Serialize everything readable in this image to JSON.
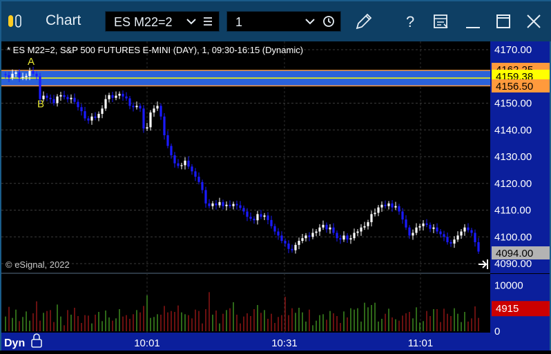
{
  "window": {
    "title": "Chart"
  },
  "toolbar": {
    "symbol": "ES M22=2",
    "interval": "1"
  },
  "icons": {
    "app": "toggle-icon",
    "symbol_dropdown": "chevron-down-icon",
    "symbol_menu": "menu-icon",
    "interval_dropdown": "chevron-down-icon",
    "interval_clock": "clock-icon",
    "draw": "pencil-icon",
    "help": "help-icon",
    "template": "template-icon",
    "minimize": "minimize-icon",
    "maximize": "maximize-icon",
    "close": "close-icon"
  },
  "colors": {
    "titlebar": "#0e3f64",
    "bull_candle": "#ffffff",
    "bear_candle": "#1a1aff",
    "zone_fill": "#2b62d9",
    "zone_border": "#ff9a3c",
    "price_axis_bg": "#0b1f9c",
    "last_price_bg": "#b3b3b3",
    "volume_up": "#4caf28",
    "volume_down": "#b21a1a",
    "volume_label_bg": "#cc0000"
  },
  "chart_data": {
    "type": "candlestick",
    "title": "* ES M22=2, S&P 500 FUTURES E-MINI (DAY), 1, 09:30-16:15 (Dynamic)",
    "copyright": "© eSignal, 2022",
    "price_axis": {
      "ticks": [
        "4170.00",
        "4160.00",
        "4150.00",
        "4140.00",
        "4130.00",
        "4120.00",
        "4110.00",
        "4100.00",
        "4090.00"
      ],
      "range": [
        4089,
        4173
      ]
    },
    "price_labels": [
      {
        "value": "4162.25",
        "color": "#ff9a3c"
      },
      {
        "value": "4159.38",
        "color": "#ffff00"
      },
      {
        "value": "4156.50",
        "color": "#ff9a3c"
      },
      {
        "value": "4094.00",
        "color": "#b3b3b3"
      }
    ],
    "zone": {
      "top": 4162.25,
      "mid": 4159.38,
      "bottom": 4156.5,
      "label_top": "A",
      "label_bottom": "B"
    },
    "time_axis": {
      "ticks": [
        "10:01",
        "10:31",
        "11:01"
      ],
      "left_label": "Dyn"
    },
    "volume_axis": {
      "ticks": [
        "10000",
        "0"
      ],
      "range": [
        0,
        12000
      ]
    },
    "volume_label": "4915",
    "closes": [
      4160.5,
      4159.5,
      4161.0,
      4161.5,
      4159.5,
      4159.8,
      4160.2,
      4162.0,
      4161.0,
      4160.0,
      4151.5,
      4152.8,
      4152.0,
      4151.5,
      4150.0,
      4152.5,
      4153.0,
      4152.3,
      4151.5,
      4152.0,
      4150.5,
      4148.5,
      4147.0,
      4144.3,
      4143.5,
      4145.0,
      4144.5,
      4146.0,
      4148.0,
      4151.5,
      4153.0,
      4152.0,
      4152.8,
      4153.5,
      4152.5,
      4151.8,
      4149.0,
      4148.5,
      4149.0,
      4148.0,
      4140.5,
      4141.0,
      4146.5,
      4148.0,
      4149.0,
      4145.0,
      4138.0,
      4134.0,
      4130.5,
      4127.5,
      4126.5,
      4126.8,
      4128.5,
      4126.3,
      4124.5,
      4122.5,
      4120.5,
      4117.5,
      4112.5,
      4111.5,
      4112.5,
      4111.8,
      4113.0,
      4111.5,
      4112.0,
      4111.5,
      4112.3,
      4111.8,
      4110.8,
      4109.5,
      4107.5,
      4106.8,
      4106.2,
      4108.5,
      4107.5,
      4108.0,
      4106.3,
      4104.0,
      4102.0,
      4100.5,
      4098.5,
      4097.5,
      4095.5,
      4095.0,
      4097.0,
      4098.5,
      4099.5,
      4100.5,
      4100.0,
      4101.5,
      4102.0,
      4103.5,
      4104.5,
      4102.8,
      4103.5,
      4101.5,
      4099.5,
      4099.0,
      4100.5,
      4099.0,
      4099.5,
      4101.5,
      4102.0,
      4103.5,
      4104.0,
      4105.5,
      4108.5,
      4109.0,
      4111.0,
      4112.0,
      4111.5,
      4112.5,
      4111.0,
      4111.5,
      4109.5,
      4106.5,
      4103.5,
      4100.5,
      4101.5,
      4103.5,
      4104.0,
      4105.0,
      4104.5,
      4103.0,
      4103.5,
      4102.0,
      4101.0,
      4100.0,
      4098.0,
      4097.5,
      4099.0,
      4100.5,
      4102.0,
      4103.5,
      4102.5,
      4101.5,
      4098.0,
      4094.5
    ],
    "volumes": [
      3200,
      5300,
      2900,
      4700,
      2200,
      3100,
      4300,
      2300,
      3900,
      6500,
      2300,
      4000,
      4400,
      4600,
      2000,
      5800,
      3200,
      1300,
      4600,
      3600,
      5100,
      3300,
      1800,
      3500,
      3400,
      1700,
      3600,
      4200,
      2200,
      4500,
      3000,
      2300,
      2800,
      4800,
      3200,
      3500,
      2700,
      3700,
      4600,
      4100,
      5500,
      7800,
      2900,
      3100,
      3700,
      3600,
      5500,
      4100,
      4400,
      4200,
      5600,
      4100,
      3700,
      3500,
      2800,
      4700,
      4400,
      1700,
      4800,
      8500,
      3600,
      4500,
      1700,
      3800,
      4600,
      5000,
      6300,
      3600,
      1700,
      3200,
      3900,
      3300,
      4800,
      5700,
      4000,
      4600,
      2700,
      3800,
      1800,
      3100,
      3500,
      7500,
      3500,
      5000,
      4000,
      5100,
      4100,
      2100,
      4700,
      1300,
      2300,
      3500,
      3700,
      2500,
      4400,
      3900,
      3300,
      1800,
      4300,
      3000,
      5000,
      4700,
      5000,
      2100,
      6200,
      5200,
      5700,
      6200,
      2100,
      2700,
      3800,
      4900,
      3000,
      2600,
      2300,
      3400,
      3900,
      4200,
      2800,
      5200,
      1900,
      2200,
      4400,
      3300,
      4800,
      4800,
      2000,
      4900,
      3800,
      3300,
      5000,
      3800,
      2000,
      4200,
      2100,
      2800,
      5400,
      2900
    ]
  }
}
